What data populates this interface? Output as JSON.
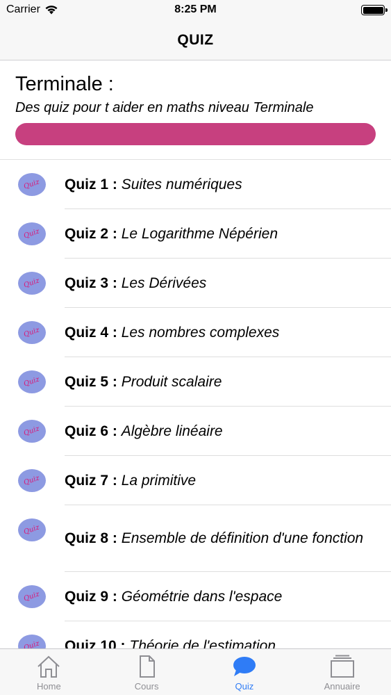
{
  "status_bar": {
    "carrier": "Carrier",
    "time": "8:25 PM"
  },
  "nav": {
    "title": "QUIZ"
  },
  "header": {
    "title": "Terminale :",
    "subtitle": "Des quiz pour t aider en maths niveau Terminale",
    "progress": 1.0,
    "progress_color": "#c7407f"
  },
  "quiz_icon_text": "Quiz",
  "quizzes": [
    {
      "num": "Quiz 1 :",
      "title": "Suites numériques"
    },
    {
      "num": "Quiz 2 :",
      "title": "Le Logarithme Népérien"
    },
    {
      "num": "Quiz 3 :",
      "title": "Les Dérivées"
    },
    {
      "num": "Quiz 4 :",
      "title": "Les nombres complexes"
    },
    {
      "num": "Quiz 5 :",
      "title": "Produit scalaire"
    },
    {
      "num": "Quiz 6 :",
      "title": "Algèbre linéaire"
    },
    {
      "num": "Quiz 7 :",
      "title": "La primitive"
    },
    {
      "num": "Quiz 8 :",
      "title": "Ensemble de définition d'une fonction"
    },
    {
      "num": "Quiz 9 :",
      "title": "Géométrie dans l'espace"
    },
    {
      "num": "Quiz 10 :",
      "title": "Théorie de l'estimation"
    }
  ],
  "tabs": [
    {
      "label": "Home",
      "icon": "home-icon"
    },
    {
      "label": "Cours",
      "icon": "document-icon"
    },
    {
      "label": "Quiz",
      "icon": "chat-bubble-icon",
      "active": true
    },
    {
      "label": "Annuaire",
      "icon": "directory-icon"
    }
  ],
  "colors": {
    "accent": "#2f7cf6",
    "inactive": "#8e8e93",
    "icon_bg": "#8d9ae2",
    "icon_text": "#d81b79"
  }
}
